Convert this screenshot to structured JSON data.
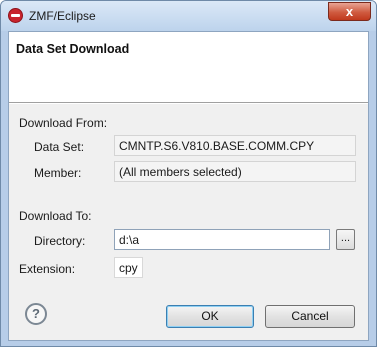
{
  "window": {
    "title": "ZMF/Eclipse",
    "close_label": "x"
  },
  "dialog": {
    "heading": "Data Set Download"
  },
  "download_from": {
    "section_label": "Download From:",
    "data_set_label": "Data Set:",
    "data_set_value": "CMNTP.S6.V810.BASE.COMM.CPY",
    "member_label": "Member:",
    "member_value": "(All members selected)"
  },
  "download_to": {
    "section_label": "Download To:",
    "directory_label": "Directory:",
    "directory_value": "d:\\a",
    "browse_label": "...",
    "extension_label": "Extension:",
    "extension_value": "cpy"
  },
  "buttons": {
    "help": "?",
    "ok": "OK",
    "cancel": "Cancel"
  },
  "icons": {
    "app": "zmf-app-icon",
    "help": "help-icon"
  }
}
